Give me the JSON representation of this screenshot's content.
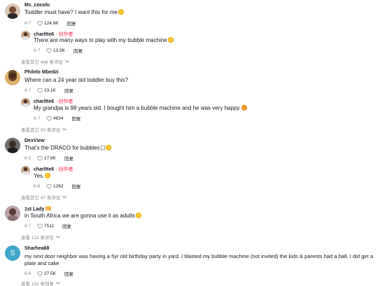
{
  "comments": [
    {
      "username": "Ms_cocolu",
      "text": "Toddler must have? I want this for me",
      "date": "6-7",
      "likes": "124.9K",
      "reply_label": "回复",
      "reply": {
        "username": "charltte6",
        "author_tag": "· 创作者",
        "text": "There are many ways to play with my bubble machine",
        "date": "6-7",
        "likes": "13.5K",
        "reply_label": "回复"
      },
      "view_more": "查看其它 448 条评论"
    },
    {
      "username": "Philelo Mbedzi",
      "text": "Where can a 24 year old toddler buy this?",
      "date": "6-7",
      "likes": "23.1K",
      "reply_label": "回复",
      "reply": {
        "username": "charltte6",
        "author_tag": "· 创作者",
        "text": "My grandpa is 98 years old. I bought him a bubble machine and he was very happy.",
        "date": "6-7",
        "likes": "4834",
        "reply_label": "回复"
      },
      "view_more": "查看其它 90 条评论"
    },
    {
      "username": "DexView",
      "text": "That's the DRACO for bubbles",
      "date": "6-5",
      "likes": "17.8K",
      "reply_label": "回复",
      "reply": {
        "username": "charltte6",
        "author_tag": "· 创作者",
        "text": "Yes.",
        "date": "6-6",
        "likes": "1262",
        "reply_label": "回复"
      },
      "view_more": "查看其它 47 条评论"
    },
    {
      "username": "1st Lady",
      "text": "in South Africa we are gonna use it as adults",
      "date": "6-7",
      "likes": "7511",
      "reply_label": "回复",
      "view_more": "查看 122 条评论"
    },
    {
      "username": "Sharhea68",
      "avatar_letter": "S",
      "text_line1": "my next door neighbor was having a 5yr old birthday party in yard. I blasted my bubble machine (not invited) the kids & parents had a ball. I did get a",
      "text_line2": "plate and cake",
      "date": "6-6",
      "likes": "27.5K",
      "reply_label": "回复",
      "view_more": "查看 132 条回复"
    }
  ],
  "colors": {
    "author_tag": "#fe2c55",
    "muted": "#8a8b91",
    "avatar_s": "#3fa6c9"
  }
}
